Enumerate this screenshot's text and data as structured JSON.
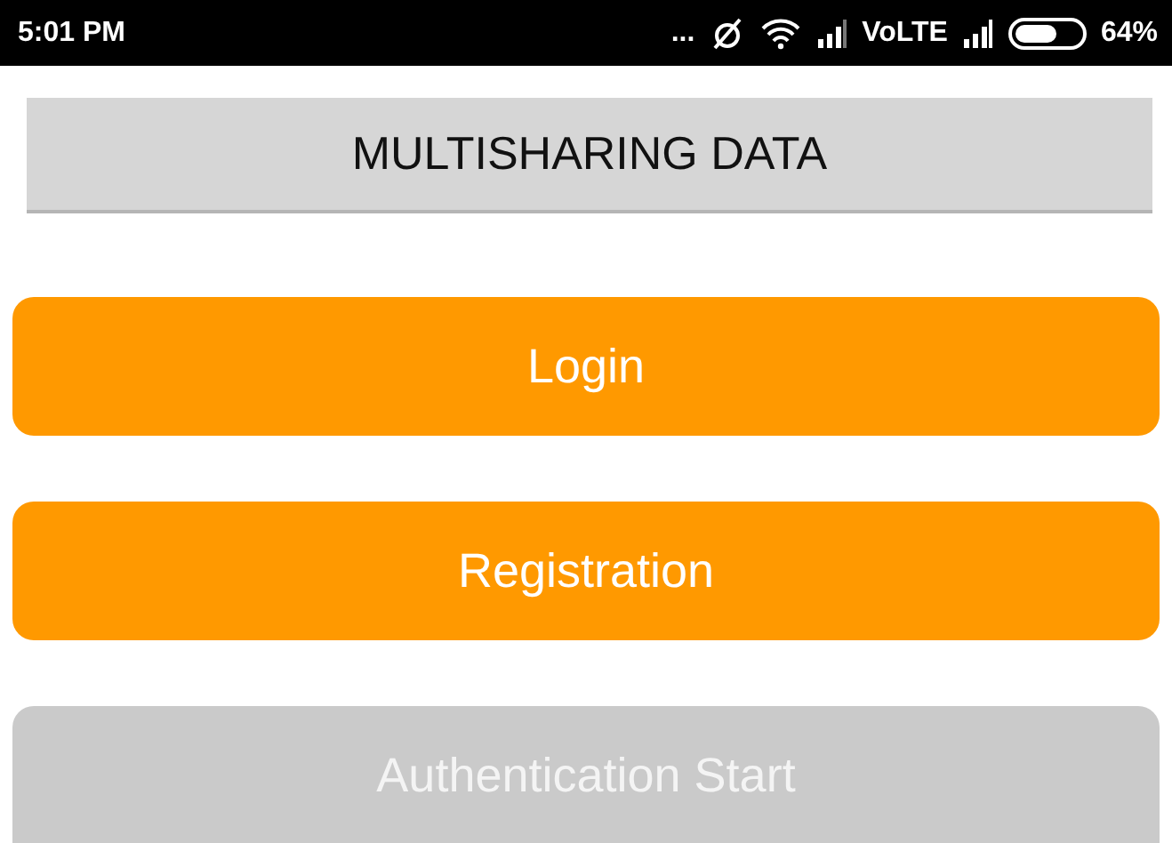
{
  "status_bar": {
    "time": "5:01 PM",
    "more": "...",
    "network": "VoLTE",
    "battery": "64%"
  },
  "title": "MULTISHARING DATA",
  "buttons": [
    {
      "label": "Login",
      "disabled": false
    },
    {
      "label": "Registration",
      "disabled": false
    },
    {
      "label": "Authentication Start",
      "disabled": true
    }
  ]
}
